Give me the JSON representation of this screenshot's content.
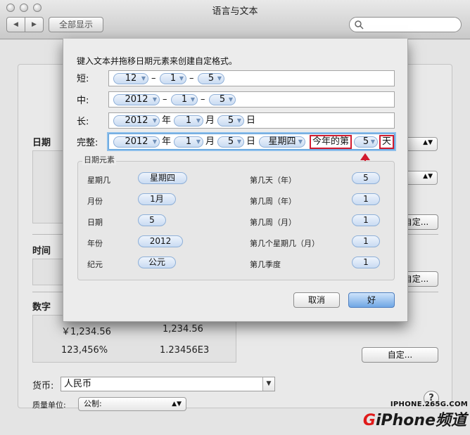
{
  "window": {
    "title": "语言与文本"
  },
  "toolbar": {
    "back": "◀",
    "forward": "▶",
    "show_all": "全部显示"
  },
  "sections": {
    "date": "日期",
    "time": "时间",
    "numbers": "数字"
  },
  "numbers": {
    "currency_sample": "￥1,234.56",
    "decimal_sample": "1,234.56",
    "percent_sample": "123,456%",
    "scientific_sample": "1.23456E3"
  },
  "buttons": {
    "customize": "自定..."
  },
  "currency": {
    "label": "货币:",
    "value": "人民币"
  },
  "measurement": {
    "label": "质量单位:",
    "value": "公制:"
  },
  "help": "?",
  "watermark": {
    "url": "IPHONE.265G.COM",
    "brand_g": "G",
    "brand_rest": "iPhone频道"
  },
  "sheet": {
    "instruction": "键入文本并拖移日期元素来创建自定格式。",
    "short": {
      "label": "短:",
      "tokens": [
        "12",
        "1",
        "5"
      ],
      "sep": "–"
    },
    "medium": {
      "label": "中:",
      "tokens": [
        "2012",
        "1",
        "5"
      ],
      "sep": "–"
    },
    "long": {
      "label": "长:",
      "tokens": [
        "2012",
        "1",
        "5"
      ],
      "literals": [
        "年",
        "月",
        "日"
      ]
    },
    "full": {
      "label": "完整:",
      "tokens": [
        "2012",
        "1",
        "5",
        "星期四"
      ],
      "literals": [
        "年",
        "月",
        "日"
      ],
      "highlight_prefix": "今年的第",
      "day_of_year": "5",
      "highlight_suffix": "天"
    },
    "elements_title": "日期元素",
    "elements_left": [
      {
        "label": "星期几",
        "value": "星期四"
      },
      {
        "label": "月份",
        "value": "1月"
      },
      {
        "label": "日期",
        "value": "5"
      },
      {
        "label": "年份",
        "value": "2012"
      },
      {
        "label": "纪元",
        "value": "公元"
      }
    ],
    "elements_right": [
      {
        "label": "第几天（年）",
        "value": "5"
      },
      {
        "label": "第几周（年）",
        "value": "1"
      },
      {
        "label": "第几周（月）",
        "value": "1"
      },
      {
        "label": "第几个星期几（月）",
        "value": "1"
      },
      {
        "label": "第几季度",
        "value": "1"
      }
    ],
    "cancel": "取消",
    "ok": "好"
  },
  "colors": {
    "highlight_red": "#d21b2e",
    "token_blue": "#c9dbf2",
    "focus_blue": "#8dbfeb"
  }
}
